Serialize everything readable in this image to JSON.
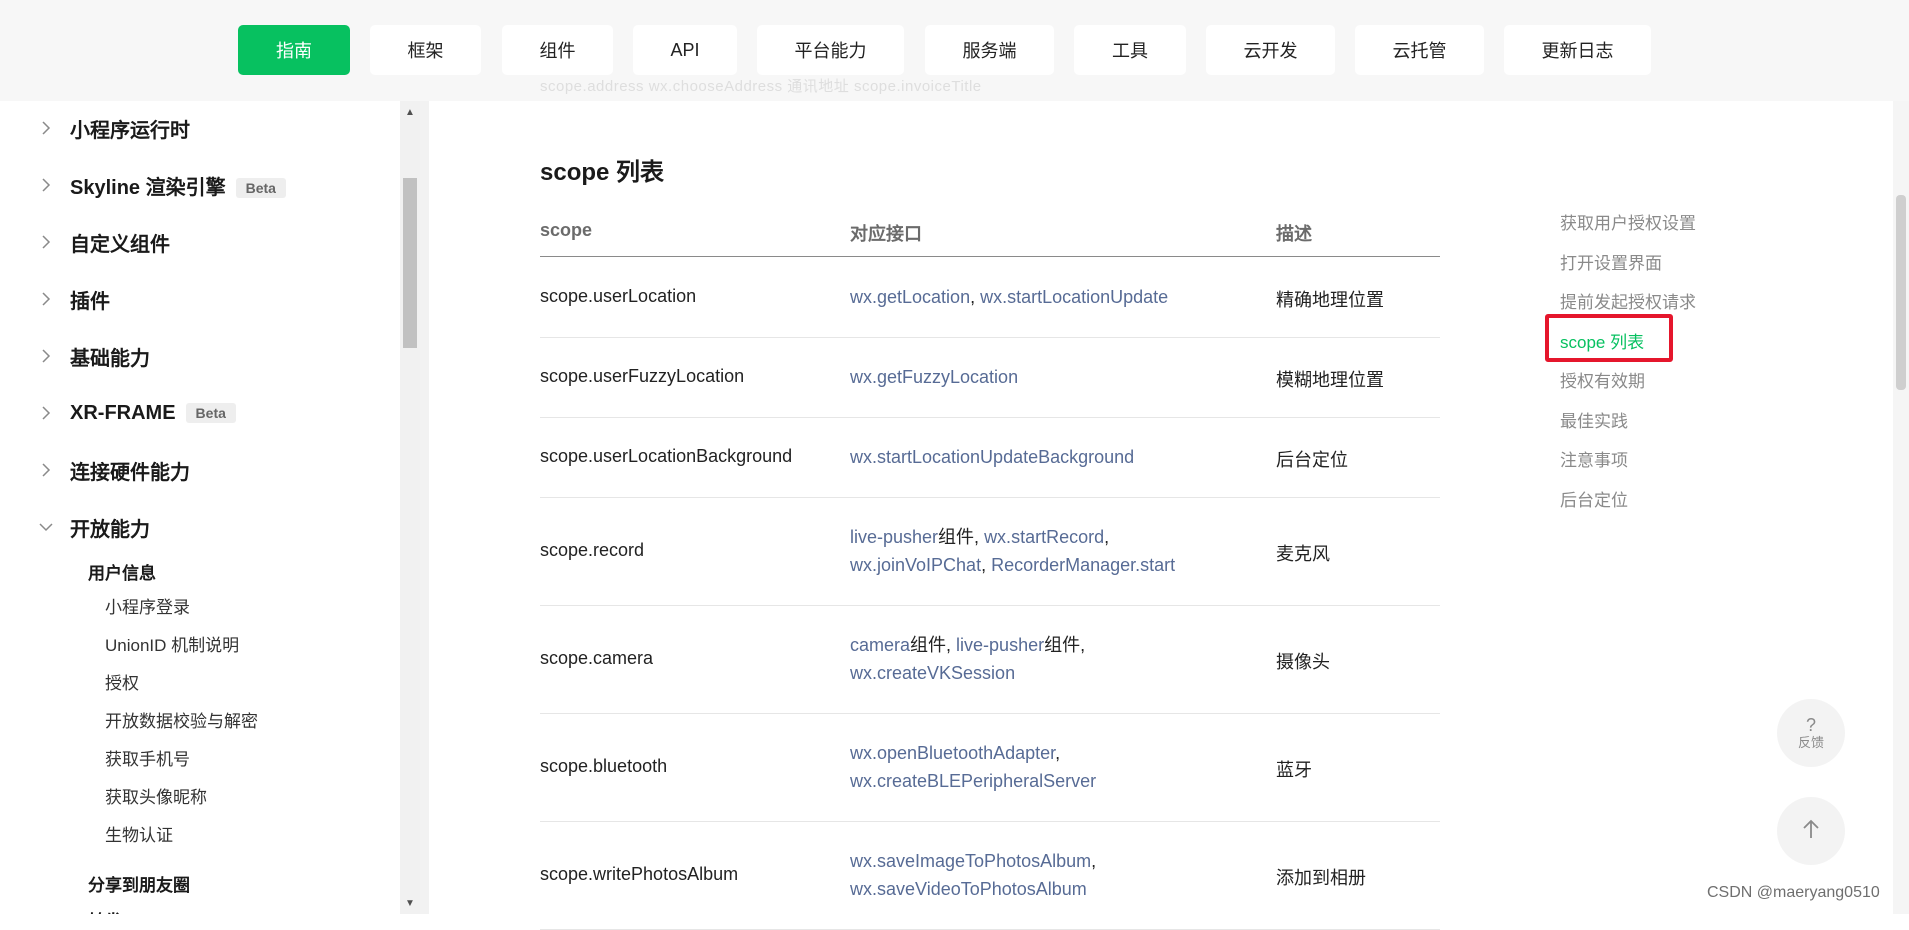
{
  "nav": {
    "items": [
      "指南",
      "框架",
      "组件",
      "API",
      "平台能力",
      "服务端",
      "工具",
      "云开发",
      "云托管",
      "更新日志"
    ],
    "active_index": 0,
    "ghost_text": "scope.address    wx.chooseAddress    通讯地址    scope.invoiceTitle"
  },
  "sidebar": {
    "groups": [
      {
        "label": "小程序运行时",
        "badge": ""
      },
      {
        "label": "Skyline 渲染引擎",
        "badge": "Beta"
      },
      {
        "label": "自定义组件",
        "badge": ""
      },
      {
        "label": "插件",
        "badge": ""
      },
      {
        "label": "基础能力",
        "badge": ""
      },
      {
        "label": "XR-FRAME",
        "badge": "Beta"
      },
      {
        "label": "连接硬件能力",
        "badge": ""
      },
      {
        "label": "开放能力",
        "badge": "",
        "expanded": true
      }
    ],
    "subsection": "用户信息",
    "leaves": [
      "小程序登录",
      "UnionID 机制说明",
      "授权",
      "开放数据校验与解密",
      "获取手机号",
      "获取头像昵称",
      "生物认证"
    ],
    "subsection2": "分享到朋友圈",
    "subsection3": "转发"
  },
  "main": {
    "title": "scope 列表",
    "headers": {
      "scope": "scope",
      "api": "对应接口",
      "desc": "描述"
    },
    "rows": [
      {
        "scope": "scope.userLocation",
        "api_line1": [
          {
            "text": "wx.getLocation",
            "link": true
          },
          {
            "text": ", ",
            "link": false
          },
          {
            "text": "wx.startLocationUpdate",
            "link": true
          }
        ],
        "api_line2": [],
        "desc": "精确地理位置"
      },
      {
        "scope": "scope.userFuzzyLocation",
        "api_line1": [
          {
            "text": "wx.getFuzzyLocation",
            "link": true
          }
        ],
        "api_line2": [],
        "desc": "模糊地理位置"
      },
      {
        "scope": "scope.userLocationBackground",
        "api_line1": [
          {
            "text": "wx.startLocationUpdateBackground",
            "link": true
          }
        ],
        "api_line2": [],
        "desc": "后台定位"
      },
      {
        "scope": "scope.record",
        "api_line1": [
          {
            "text": "live-pusher",
            "link": true
          },
          {
            "text": "组件, ",
            "link": false
          },
          {
            "text": "wx.startRecord",
            "link": true
          },
          {
            "text": ",",
            "link": false
          }
        ],
        "api_line2": [
          {
            "text": "wx.joinVoIPChat",
            "link": true
          },
          {
            "text": ", ",
            "link": false
          },
          {
            "text": "RecorderManager.start",
            "link": true
          }
        ],
        "desc": "麦克风"
      },
      {
        "scope": "scope.camera",
        "api_line1": [
          {
            "text": "camera",
            "link": true
          },
          {
            "text": "组件, ",
            "link": false
          },
          {
            "text": "live-pusher",
            "link": true
          },
          {
            "text": "组件,",
            "link": false
          }
        ],
        "api_line2": [
          {
            "text": "wx.createVKSession",
            "link": true
          }
        ],
        "desc": "摄像头"
      },
      {
        "scope": "scope.bluetooth",
        "api_line1": [
          {
            "text": "wx.openBluetoothAdapter",
            "link": true
          },
          {
            "text": ",",
            "link": false
          }
        ],
        "api_line2": [
          {
            "text": "wx.createBLEPeripheralServer",
            "link": true
          }
        ],
        "desc": "蓝牙"
      },
      {
        "scope": "scope.writePhotosAlbum",
        "api_line1": [
          {
            "text": "wx.saveImageToPhotosAlbum",
            "link": true
          },
          {
            "text": ",",
            "link": false
          }
        ],
        "api_line2": [
          {
            "text": "wx.saveVideoToPhotosAlbum",
            "link": true
          }
        ],
        "desc": "添加到相册"
      }
    ]
  },
  "toc": {
    "items": [
      "获取用户授权设置",
      "打开设置界面",
      "提前发起授权请求",
      "scope 列表",
      "授权有效期",
      "最佳实践",
      "注意事项",
      "后台定位"
    ],
    "active_index": 3
  },
  "fab": {
    "feedback_glyph": "?",
    "feedback_label": "反馈",
    "top_glyph": "↑"
  },
  "watermark": "CSDN @maeryang0510",
  "colors": {
    "accent": "#07c160",
    "link": "#576b95",
    "highlight": "#e5162c"
  }
}
